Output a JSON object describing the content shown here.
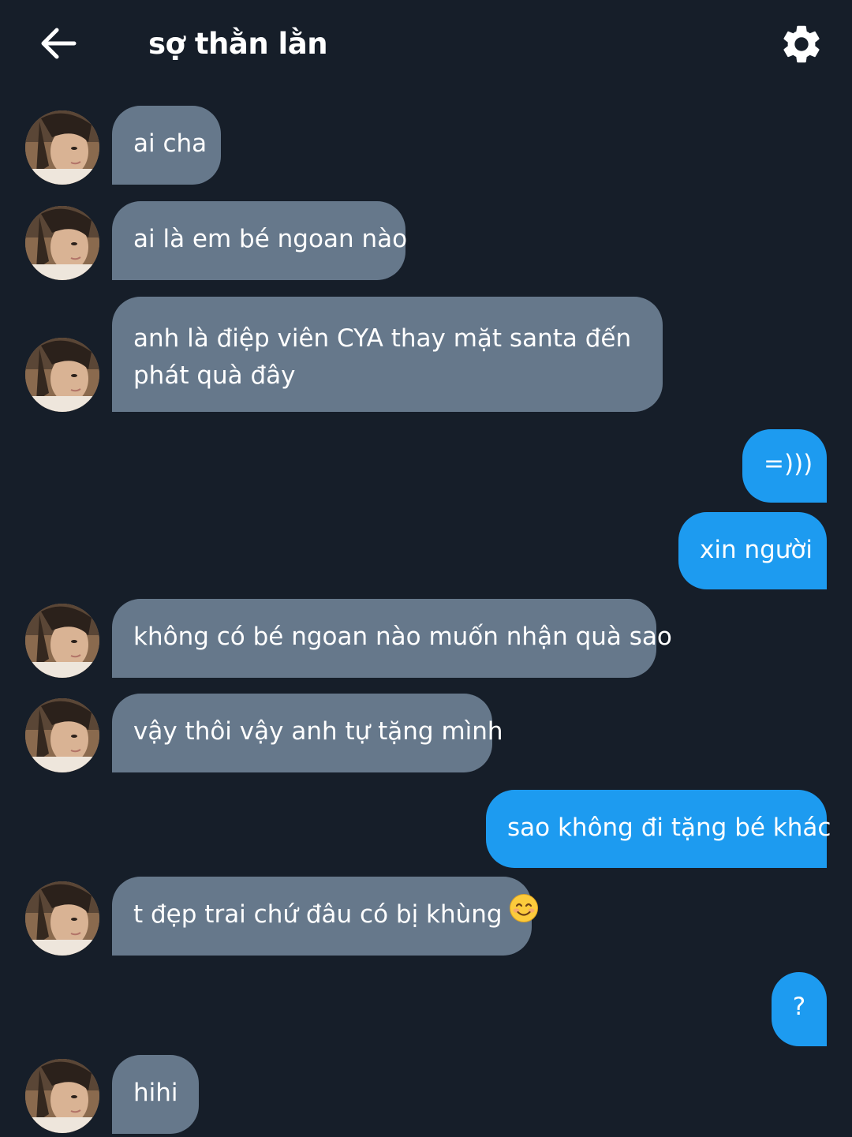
{
  "header": {
    "title": "sợ thằn lằn",
    "back_icon": "arrow-left-icon",
    "settings_icon": "gear-icon"
  },
  "colors": {
    "background": "#161e29",
    "incoming_bubble": "#66788b",
    "outgoing_bubble": "#1d9bf0"
  },
  "messages": [
    {
      "from": "them",
      "text": "ai cha"
    },
    {
      "from": "them",
      "text": "ai là em bé ngoan nào"
    },
    {
      "from": "them",
      "text": "anh là điệp viên CYA thay mặt santa đến phát quà đây"
    },
    {
      "from": "me",
      "text": "=)))"
    },
    {
      "from": "me",
      "text": "xin người"
    },
    {
      "from": "them",
      "text": "không có bé ngoan nào muốn nhận quà sao"
    },
    {
      "from": "them",
      "text": "vậy thôi vậy anh tự tặng mình"
    },
    {
      "from": "me",
      "text": "sao không đi tặng bé khác"
    },
    {
      "from": "them",
      "text": "t đẹp trai chứ đâu có bị khùng",
      "emoji": "smiling-face-icon"
    },
    {
      "from": "me",
      "text": "?"
    },
    {
      "from": "them",
      "text": "hihi"
    }
  ]
}
